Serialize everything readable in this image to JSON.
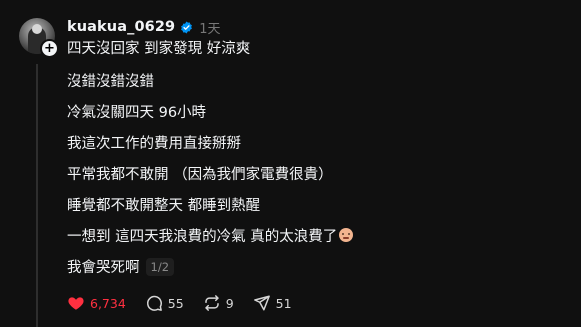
{
  "post": {
    "username": "kuakua_0629",
    "timestamp": "1天",
    "lines": [
      "四天沒回家 到家發現 好涼爽",
      "沒錯沒錯沒錯",
      "冷氣沒關四天 96小時",
      "我這次工作的費用直接掰掰",
      "平常我都不敢開 （因為我們家電費很貴）",
      "睡覺都不敢開整天 都睡到熱醒",
      "一想到 這四天我浪費的冷氣 真的太浪費了",
      "我會哭死啊"
    ],
    "page_indicator": "1/2",
    "emoji": "pleading-face-emoji"
  },
  "actions": {
    "likes": "6,734",
    "comments": "55",
    "reposts": "9",
    "shares": "51"
  },
  "colors": {
    "background": "#101010",
    "text": "#f3f5f7",
    "muted": "#777777",
    "like": "#ff3040",
    "verified": "#0095f6"
  },
  "icons": {
    "verified": "verified-badge-icon",
    "follow": "plus-icon",
    "like": "heart-icon",
    "comment": "comment-bubble-icon",
    "repost": "repost-icon",
    "share": "send-icon"
  }
}
